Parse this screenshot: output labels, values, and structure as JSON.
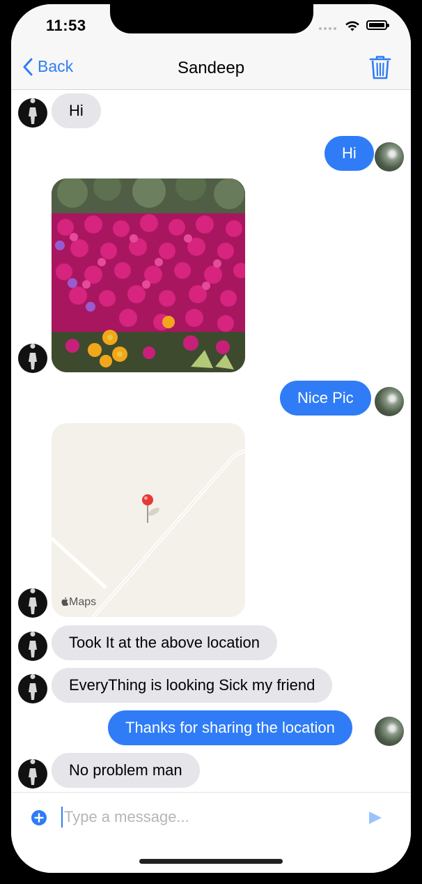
{
  "status_bar": {
    "time": "11:53"
  },
  "nav": {
    "back_label": "Back",
    "title": "Sandeep"
  },
  "messages": [
    {
      "dir": "in",
      "type": "text",
      "text": "Hi"
    },
    {
      "dir": "out",
      "type": "text",
      "text": "Hi"
    },
    {
      "dir": "in",
      "type": "photo",
      "description": "flower-photo"
    },
    {
      "dir": "out",
      "type": "text",
      "text": "Nice Pic"
    },
    {
      "dir": "in",
      "type": "location",
      "map_label": "Maps"
    },
    {
      "dir": "in",
      "type": "text",
      "text": "Took It at the above location"
    },
    {
      "dir": "in",
      "type": "text",
      "text": "EveryThing is looking Sick my friend"
    },
    {
      "dir": "out",
      "type": "text",
      "text": "Thanks for sharing the location"
    },
    {
      "dir": "in",
      "type": "text",
      "text": "No problem man"
    }
  ],
  "composer": {
    "placeholder": "Type a message...",
    "value": ""
  },
  "colors": {
    "accent": "#2f7cf6",
    "incoming_bubble": "#e5e5ea",
    "outgoing_bubble": "#2f7cf6",
    "map_pin": "#e53935"
  },
  "icons": [
    "chevron-left-icon",
    "trash-icon",
    "plus-circle-icon",
    "send-icon",
    "wifi-icon",
    "battery-icon",
    "map-pin-icon",
    "apple-icon"
  ]
}
